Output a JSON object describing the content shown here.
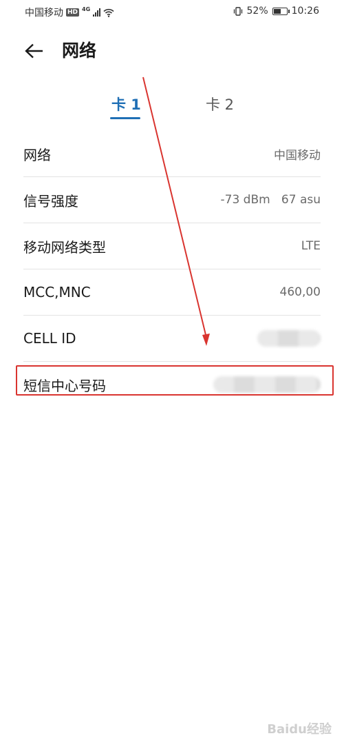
{
  "status_bar": {
    "carrier": "中国移动",
    "hd": "HD",
    "network_gen": "4G",
    "battery_percent": "52%",
    "battery_level": 0.52,
    "time": "10:26"
  },
  "header": {
    "title": "网络"
  },
  "tabs": [
    {
      "label": "卡 1",
      "selected": true
    },
    {
      "label": "卡 2",
      "selected": false
    }
  ],
  "rows": [
    {
      "label": "网络",
      "value": "中国移动"
    },
    {
      "label": "信号强度",
      "value": "-73 dBm   67 asu"
    },
    {
      "label": "移动网络类型",
      "value": "LTE"
    },
    {
      "label": "MCC,MNC",
      "value": "460,00"
    },
    {
      "label": "CELL ID",
      "value": ""
    },
    {
      "label": "短信中心号码",
      "value": ""
    }
  ],
  "annotation_color": "#d9342f",
  "accent_color": "#1f6fb5",
  "watermark": "Baidu经验"
}
